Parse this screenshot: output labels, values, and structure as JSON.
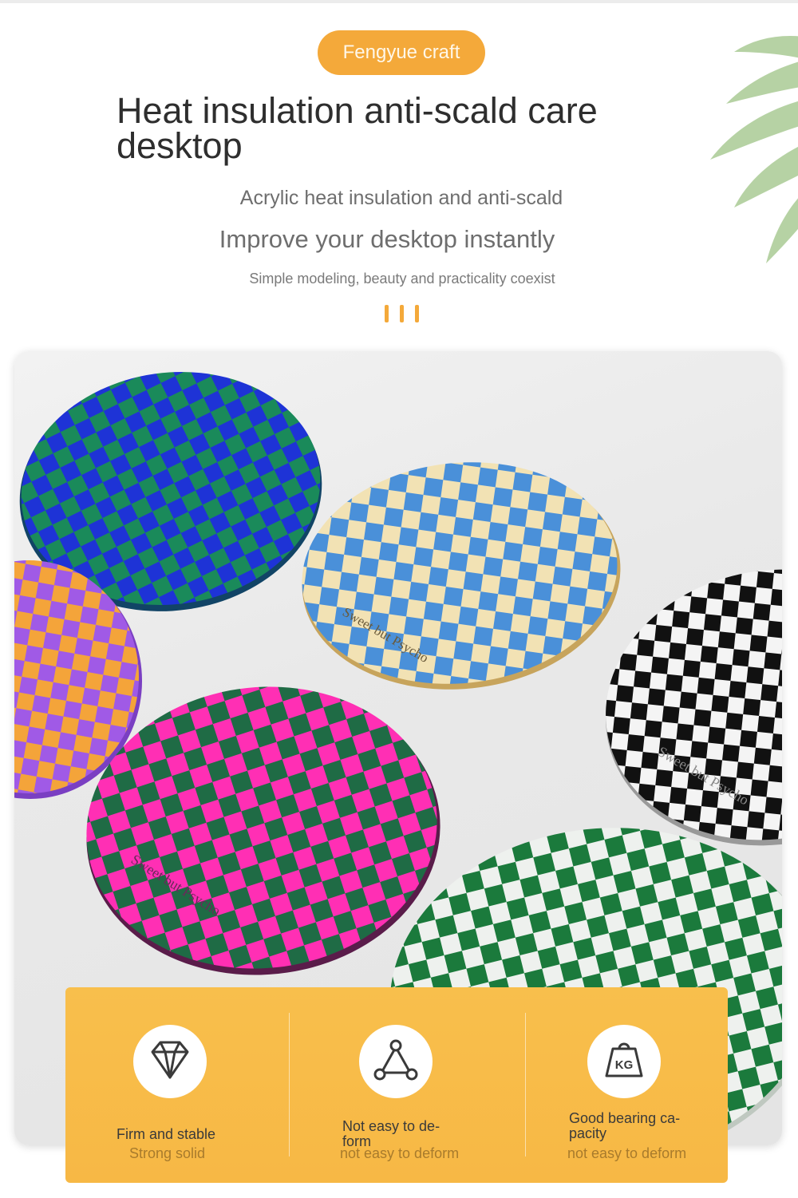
{
  "header": {
    "badge": "Fengyue craft",
    "title": "Heat insulation anti-scald care desktop",
    "subtitle_1": "Acrylic heat insulation and anti-scald",
    "subtitle_2": "Improve your desktop instantly",
    "subtitle_3": "Simple modeling, beauty and practicality coexist"
  },
  "photo": {
    "engraving": "Sweet but Psycho"
  },
  "features": [
    {
      "icon": "diamond-icon",
      "label": "Firm and stable",
      "note": "Strong solid"
    },
    {
      "icon": "triangle-nodes-icon",
      "label": "Not easy to de-\nform",
      "note": "not easy to deform"
    },
    {
      "icon": "kg-weight-icon",
      "label": "Good bearing ca-\npacity",
      "note": "not easy to deform",
      "icon_text": "KG"
    }
  ],
  "colors": {
    "accent": "#f4a93a",
    "panel": "#f8bf4c",
    "title_text": "#2e2e2e",
    "subtitle_text": "#6e6e6e"
  }
}
